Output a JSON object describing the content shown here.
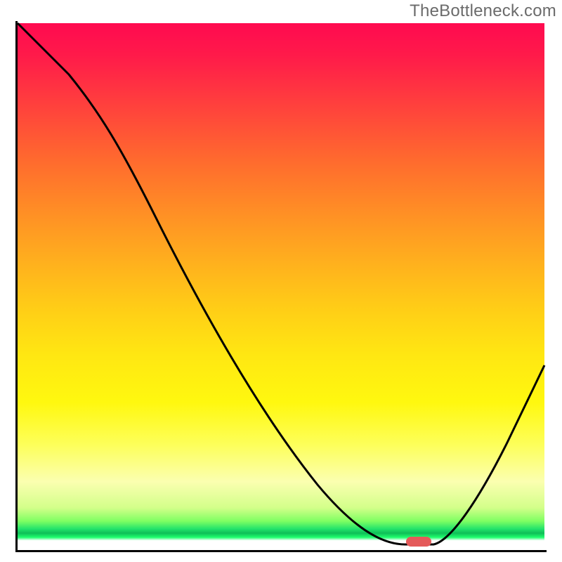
{
  "watermark": "TheBottleneck.com",
  "chart_data": {
    "type": "line",
    "title": "",
    "xlabel": "",
    "ylabel": "",
    "xlim": [
      0,
      100
    ],
    "ylim": [
      0,
      100
    ],
    "grid": false,
    "legend": false,
    "series": [
      {
        "name": "bottleneck-curve",
        "x": [
          0,
          10,
          22,
          35,
          50,
          62,
          70,
          74,
          78,
          84,
          100
        ],
        "y": [
          100,
          90,
          78,
          62,
          40,
          20,
          5,
          0,
          0,
          3,
          35
        ]
      }
    ],
    "annotations": [
      {
        "name": "optimal-marker",
        "x": 76,
        "y": 0
      }
    ],
    "colors": {
      "curve": "#000000",
      "marker": "#e45a5a",
      "gradient_top": "#ff0a50",
      "gradient_mid": "#ffe712",
      "gradient_green": "#22e36b"
    }
  }
}
